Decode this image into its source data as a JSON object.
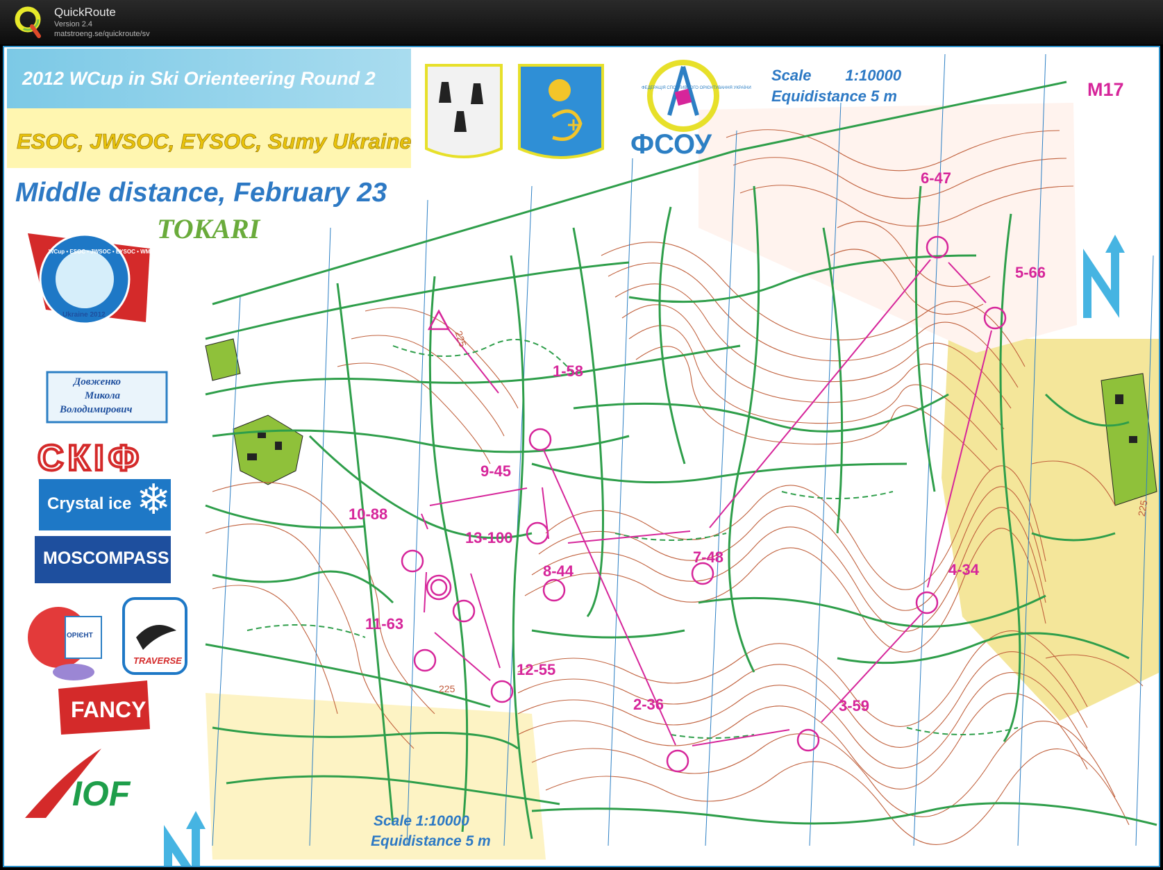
{
  "app": {
    "name": "QuickRoute",
    "version": "Version 2.4",
    "url": "matstroeng.se/quickroute/sv"
  },
  "map": {
    "event_title": "2012 WCup in Ski Orienteering Round 2",
    "event_subtitle": "ESOC, JWSOC, EYSOC, Sumy Ukraine",
    "race_title": "Middle distance, February 23",
    "venue": "TOKARI",
    "class_label": "M17",
    "scale_top": "Scale        1:10000",
    "equidistance_top": "Equidistance  5 m",
    "scale_bottom": "Scale  1:10000",
    "equidistance_bottom": "Equidistance  5 m",
    "contour_labels": [
      "225",
      "225",
      "225"
    ],
    "sponsors": {
      "fsou": "ФСОУ",
      "fsou_ring": "ФЕДЕРАЦІЯ СПОРТИВНОГО ОРІЄНТУВАННЯ УКРАЇНИ",
      "badge_ring": "WCup • ESOC • JWSOC • EYSOC • WMSOC",
      "badge_year": "Ukraine 2012",
      "sign_lines": [
        "Довженко",
        "Микола",
        "Володимирович"
      ],
      "skif": "СКІФ",
      "crystal_ice": "Crystal ice",
      "moscompass": "MOSCOMPASS",
      "orient_mascot": "ОРІЄНТ",
      "traverse": "TRAVERSE",
      "fancy": "FANCY",
      "iof": "IOF"
    },
    "controls": [
      {
        "label": "1-58"
      },
      {
        "label": "2-36"
      },
      {
        "label": "3-59"
      },
      {
        "label": "4-34"
      },
      {
        "label": "5-66"
      },
      {
        "label": "6-47"
      },
      {
        "label": "7-48"
      },
      {
        "label": "8-44"
      },
      {
        "label": "9-45"
      },
      {
        "label": "10-88"
      },
      {
        "label": "11-63"
      },
      {
        "label": "12-55"
      },
      {
        "label": "13-100"
      }
    ]
  },
  "colors": {
    "course": "#d6259a",
    "trail": "#2e9e4a",
    "contour": "#c0603c",
    "magnetic_north": "#2c7fc4",
    "field": "#f4e69a",
    "settlement": "#8fc13a",
    "title_blue": "#2d79c4"
  }
}
